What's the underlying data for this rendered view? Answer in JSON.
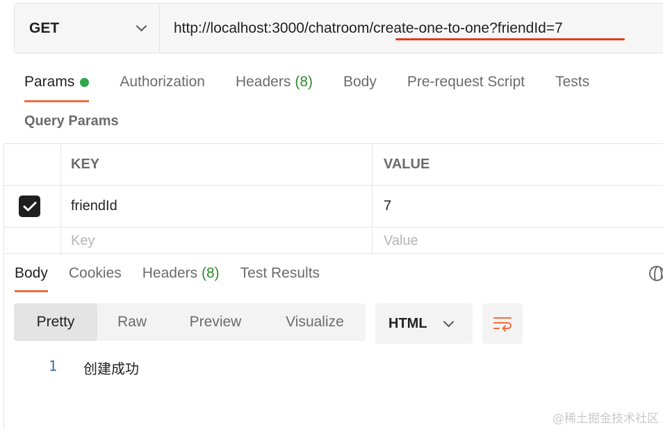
{
  "request": {
    "method": "GET",
    "url": "http://localhost:3000/chatroom/create-one-to-one?friendId=7"
  },
  "request_tabs": [
    {
      "label": "Params",
      "active": true,
      "dot": true
    },
    {
      "label": "Authorization"
    },
    {
      "label": "Headers",
      "count": "(8)"
    },
    {
      "label": "Body"
    },
    {
      "label": "Pre-request Script"
    },
    {
      "label": "Tests"
    }
  ],
  "query_params": {
    "title": "Query Params",
    "headers": {
      "key": "KEY",
      "value": "VALUE"
    },
    "rows": [
      {
        "checked": true,
        "key": "friendId",
        "value": "7"
      }
    ],
    "placeholders": {
      "key": "Key",
      "value": "Value"
    }
  },
  "response_tabs": [
    {
      "label": "Body",
      "active": true
    },
    {
      "label": "Cookies"
    },
    {
      "label": "Headers",
      "count": "(8)"
    },
    {
      "label": "Test Results"
    }
  ],
  "view_modes": [
    "Pretty",
    "Raw",
    "Preview",
    "Visualize"
  ],
  "active_view": "Pretty",
  "format": "HTML",
  "response_body": {
    "line": "1",
    "text": "创建成功"
  },
  "watermark": "@稀土掘金技术社区",
  "colors": {
    "accent": "#f26b3a",
    "url_highlight": "#e8371c",
    "success": "#2ea84a"
  },
  "icons": [
    "chevron-down-icon",
    "checkbox-checked-icon",
    "globe-icon",
    "wrap-lines-icon"
  ]
}
